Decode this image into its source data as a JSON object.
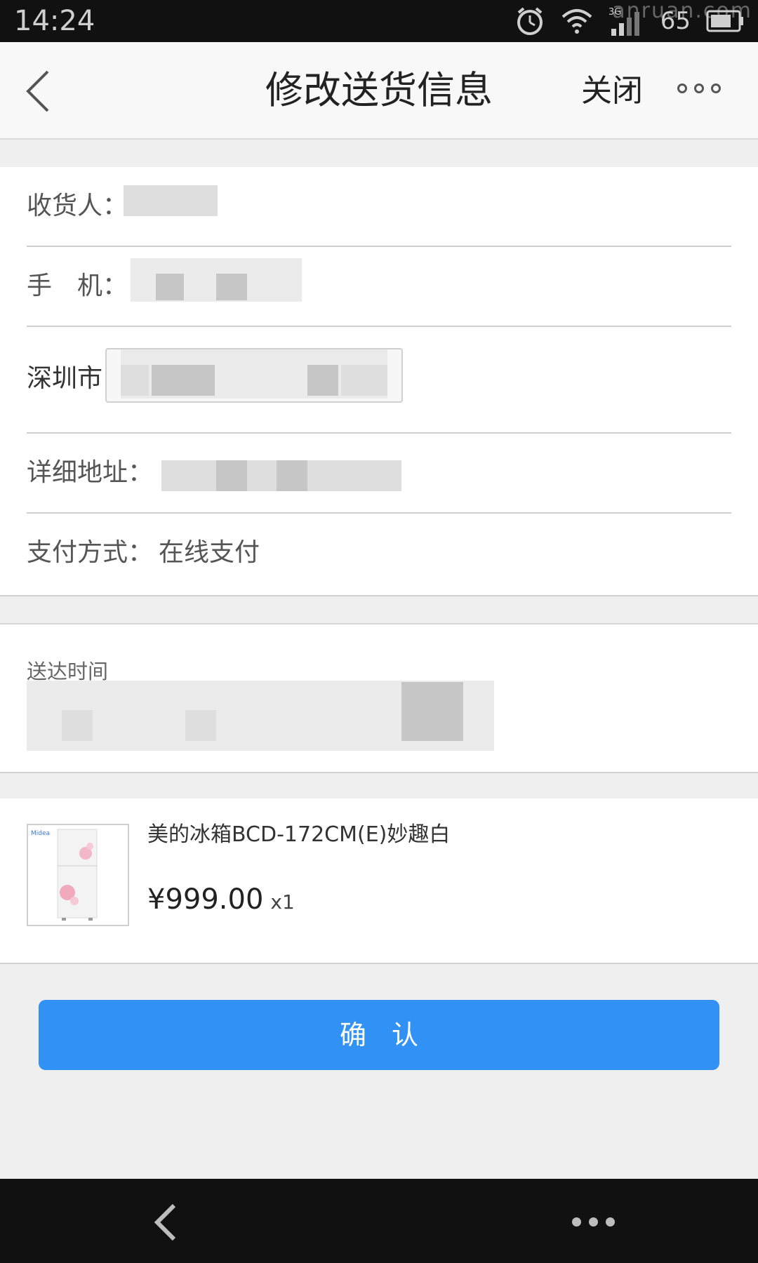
{
  "status_bar": {
    "time": "14:24",
    "network": "3G",
    "battery": "65",
    "watermark": "anruan.com",
    "icons": [
      "alarm-icon",
      "wifi-icon",
      "signal-icon",
      "battery-icon"
    ]
  },
  "nav": {
    "back_icon": "chevron-left-icon",
    "title": "修改送货信息",
    "close_label": "关闭",
    "more_icon": "more-dots-icon"
  },
  "form": {
    "recipient_label": "收货人：",
    "phone_label": "手　机：",
    "city_label": "深圳市",
    "address_label": "详细地址：",
    "payment_label": "支付方式：",
    "payment_value": "在线支付"
  },
  "delivery": {
    "label": "送达时间"
  },
  "product": {
    "name": "美的冰箱BCD-172CM(E)妙趣白",
    "price": "¥999.00",
    "quantity": "x1",
    "thumb_brand": "Midea"
  },
  "confirm_label": "确认",
  "colors": {
    "accent": "#3191f5",
    "nav_bg": "#f8f8f8",
    "page_bg": "#efefef"
  },
  "bottom_bar": {
    "back_icon": "chevron-left-icon",
    "more_icon": "more-dots-icon"
  }
}
